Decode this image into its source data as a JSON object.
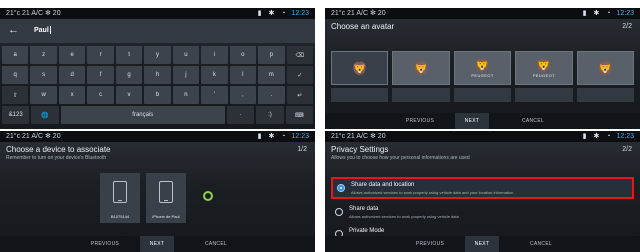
{
  "screens": [
    {
      "status": {
        "left": "21°c 21 A/C ✻ 20",
        "time": "12:23"
      },
      "search_text": "Paul",
      "keyboard": {
        "rows": [
          [
            "a",
            "z",
            "e",
            "r",
            "t",
            "y",
            "u",
            "i",
            "o",
            "p",
            "⌫"
          ],
          [
            "q",
            "s",
            "d",
            "f",
            "g",
            "h",
            "j",
            "k",
            "l",
            "m",
            "✓"
          ],
          [
            "⇧",
            "w",
            "x",
            "c",
            "v",
            "b",
            "n",
            "'",
            ",",
            ".",
            "↵"
          ],
          [
            "&123",
            "🌐",
            "français",
            "·",
            ":)",
            "⌨"
          ]
        ]
      }
    },
    {
      "status": {
        "left": "21°c 21 A/C ✻ 20",
        "time": "12:23"
      },
      "title": "Choose an avatar",
      "pager": "2/2",
      "avatars": [
        {
          "word": "",
          "glyph": "🦁"
        },
        {
          "word": "",
          "glyph": "🦁"
        },
        {
          "word": "PEUGEOT",
          "glyph": "🦁"
        },
        {
          "word": "PEUGEOT",
          "glyph": "🦁"
        },
        {
          "word": "",
          "glyph": "🦁"
        }
      ],
      "actions": [
        "PREVIOUS",
        "NEXT",
        "CANCEL"
      ]
    },
    {
      "status": {
        "left": "21°c 21 A/C ✻ 20",
        "time": "12:23"
      },
      "title": "Choose a device to associate",
      "subtitle": "Remember to turn on your device's Bluetooth",
      "pager": "1/2",
      "devices": [
        "B1075144",
        "iPhone de Paul"
      ],
      "actions": [
        "PREVIOUS",
        "NEXT",
        "CANCEL"
      ]
    },
    {
      "status": {
        "left": "21°c 21 A/C ✻ 20",
        "time": "12:23"
      },
      "title": "Privacy Settings",
      "subtitle": "Allows you to choose how your personal informations are used",
      "pager": "2/2",
      "options": [
        {
          "label": "Share data and location",
          "desc": "Allows authorized services to work properly using vehicle data and your location information",
          "selected": true
        },
        {
          "label": "Share data",
          "desc": "Allows authorized services to work properly using vehicle data",
          "selected": false
        },
        {
          "label": "Private Mode",
          "desc": "",
          "selected": false
        }
      ],
      "actions": [
        "PREVIOUS",
        "NEXT",
        "CANCEL"
      ]
    }
  ],
  "colors": {
    "accent": "#3f96d3",
    "highlight_border": "#e11919",
    "spinner": "#8fd14f"
  }
}
